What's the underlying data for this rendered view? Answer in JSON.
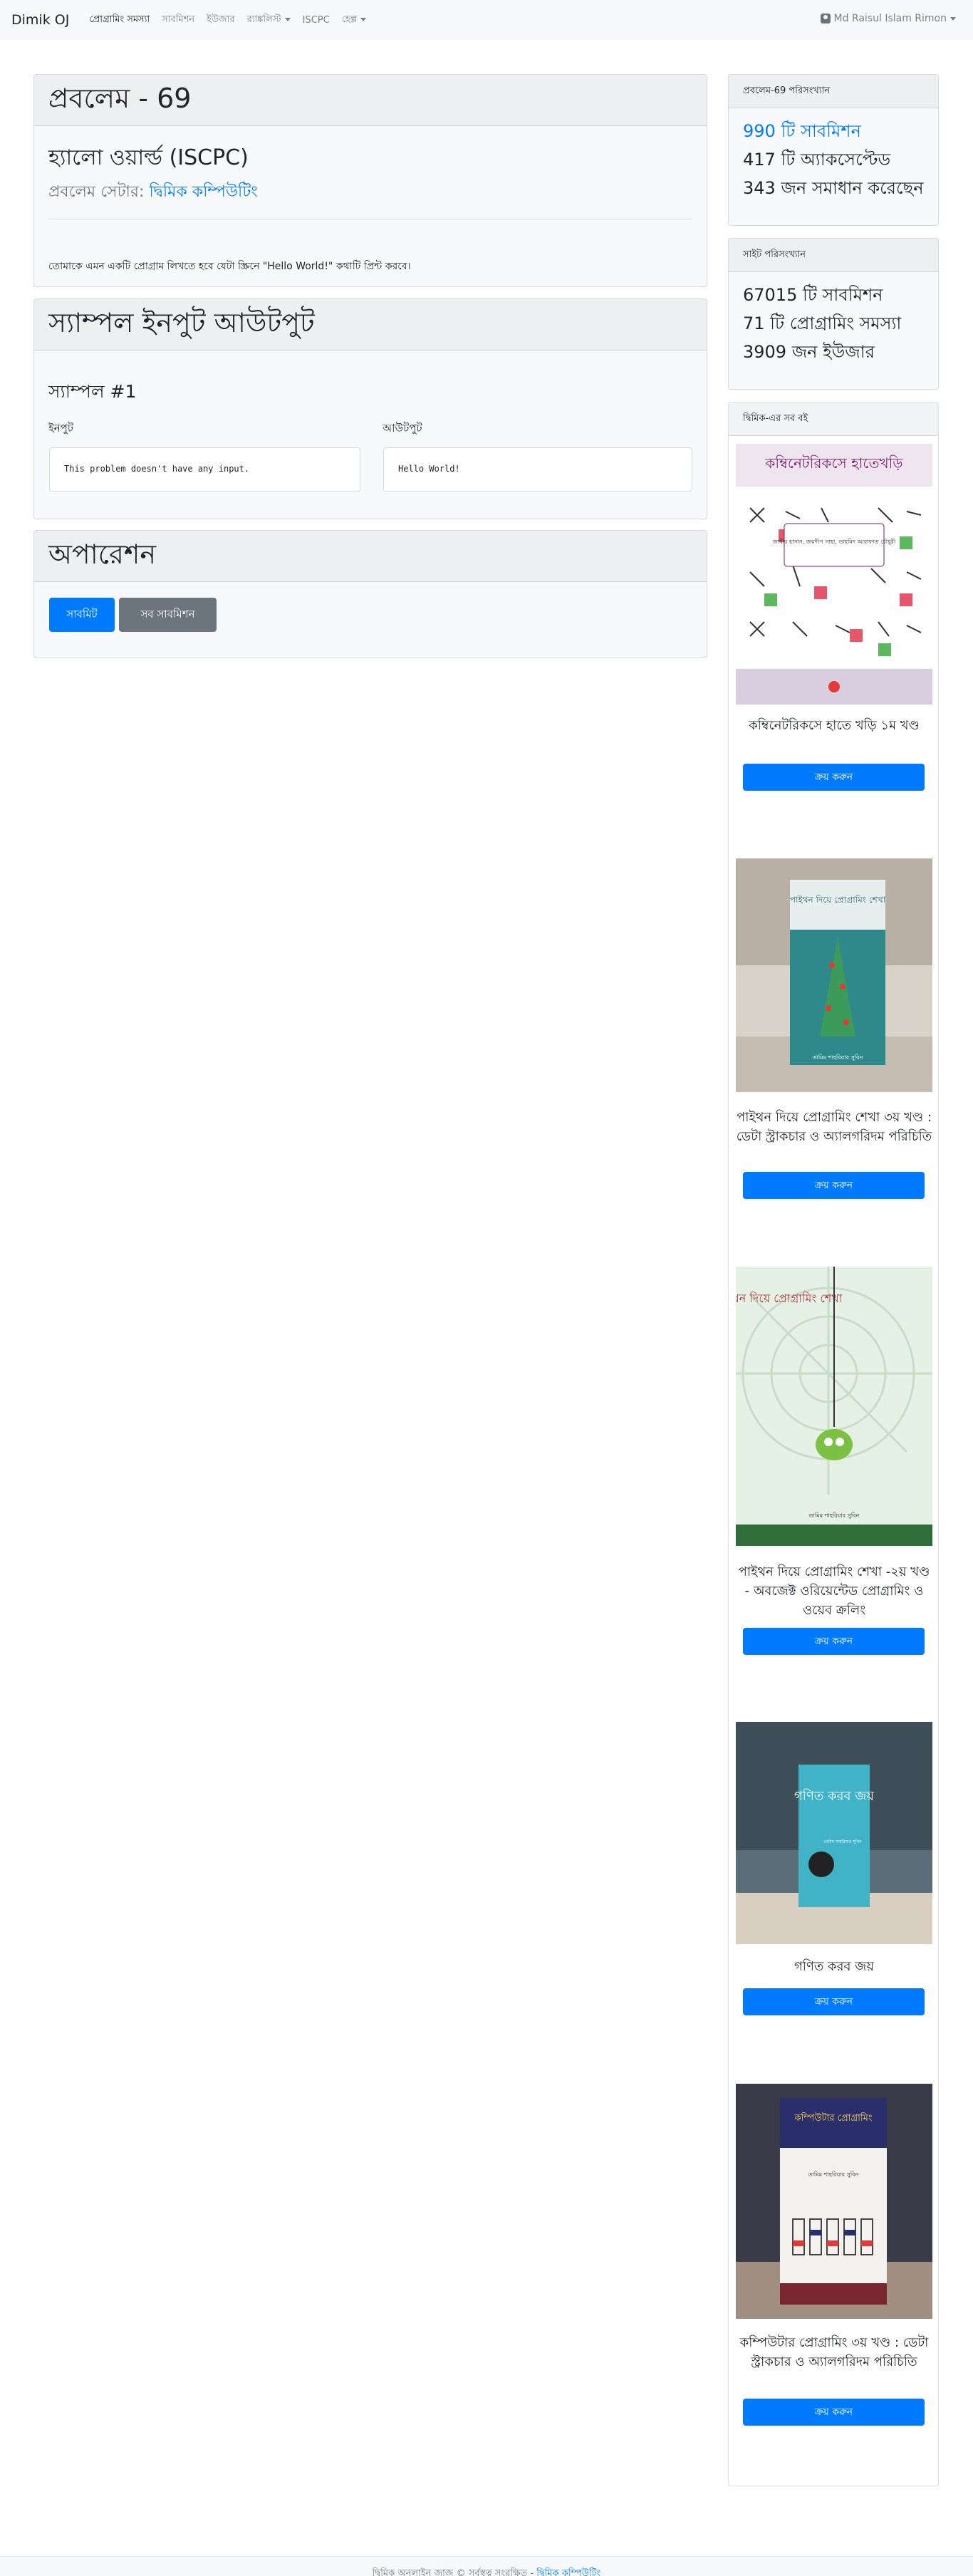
{
  "navbar": {
    "brand": "Dimik OJ",
    "links": [
      {
        "label": "প্রোগ্রামিং সমস্যা",
        "active": true
      },
      {
        "label": "সাবমিশন"
      },
      {
        "label": "ইউজার"
      },
      {
        "label": "র‍্যাঙ্কলিস্ট",
        "dropdown": true
      },
      {
        "label": "ISCPC"
      },
      {
        "label": "হেল্প",
        "dropdown": true
      }
    ],
    "user": "Md Raisul Islam Rimon"
  },
  "problem": {
    "heading": "প্রবলেম - 69",
    "title": "হ্যালো ওয়ার্ল্ড (ISCPC)",
    "setter_label": "প্রবলেম সেটার:",
    "setter_name": "দ্বিমিক কম্পিউটিং",
    "statement": "তোমাকে এমন একটি প্রোগ্রাম লিখতে হবে যেটা স্ক্রিনে \"Hello World!\" কথাটি প্রিন্ট করবে।"
  },
  "sample": {
    "heading": "স্যাম্পল ইনপুট আউটপুট",
    "case_title": "স্যাম্পল #1",
    "input_label": "ইনপুট",
    "output_label": "আউটপুট",
    "input_value": "This problem doesn't have any input.",
    "output_value": "Hello World!"
  },
  "operation": {
    "heading": "অপারেশন",
    "submit_label": "সাবমিট",
    "all_submissions_label": "সব সাবমিশন"
  },
  "problem_stats": {
    "heading": "প্রবলেম-69 পরিসংখ্যান",
    "submissions": "990 টি সাবমিশন",
    "accepted": "417 টি অ্যাকসেপ্টেড",
    "solvers": "343 জন সমাধান করেছেন"
  },
  "site_stats": {
    "heading": "সাইট পরিসংখ্যান",
    "submissions": "67015 টি সাবমিশন",
    "problems": "71 টি প্রোগ্রামিং সমস্যা",
    "users": "3909 জন ইউজার"
  },
  "books": {
    "heading": "দ্বিমিক-এর সব বই",
    "buy_label": "ক্রয় করুন",
    "items": [
      {
        "title": "কম্বিনেটরিকসে হাতে খড়ি ১ম খণ্ড",
        "cover_text": "কম্বিনেটরিকসে হাতেখড়ি",
        "cover_authors": "জাবীর হাসান, জয়দীপ সাহা, তাহমিদ আরাফাত চৌধুরী"
      },
      {
        "title": "পাইথন দিয়ে প্রোগ্রামিং শেখা ৩য় খণ্ড : ডেটা স্ট্রাকচার ও অ্যালগরিদম পরিচিতি",
        "cover_text": "পাইথন দিয়ে প্রোগ্রামিং শেখা",
        "cover_authors": "তামিম শাহরিয়ার সুবিন"
      },
      {
        "title": "পাইথন দিয়ে প্রোগ্রামিং শেখা -২য় খণ্ড - অবজেক্ট ওরিয়েন্টেড প্রোগ্রামিং ও ওয়েব ক্রলিং",
        "cover_text": "পাইথন দিয়ে প্রোগ্রামিং শেখা",
        "cover_authors": "তামিম শাহরিয়ার সুবিন"
      },
      {
        "title": "গণিত করব জয়",
        "cover_text": "গণিত করব জয়",
        "cover_authors": "তামিম শাহরিয়ার সুবিন"
      },
      {
        "title": "কম্পিউটার প্রোগ্রামিং ৩য় খণ্ড : ডেটা স্ট্রাকচার ও অ্যালগরিদম পরিচিতি",
        "cover_text": "কম্পিউটার প্রোগ্রামিং",
        "cover_authors": "তামিম শাহরিয়ার সুবিন"
      }
    ]
  },
  "footer": {
    "text": "দ্বিমিক অনলাইন জাজ © সর্বস্বত্ব সংরক্ষিত -",
    "link": "দ্বিমিক কম্পিউটিং"
  },
  "colors": {
    "primary": "#007bff",
    "secondary": "#6c757d",
    "card_bg": "#f8f9fa"
  }
}
